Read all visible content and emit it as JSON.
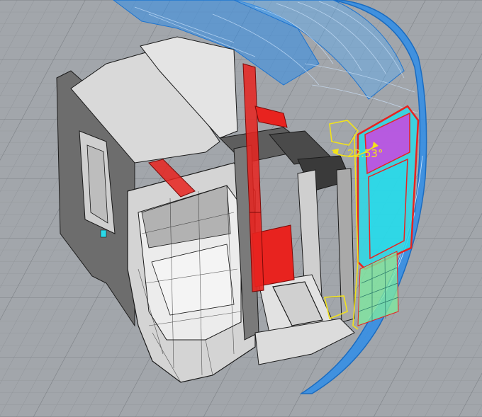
{
  "viewport": {
    "background_color": "#a2a6ab",
    "grid_color": "#8f9398",
    "grid_major_color": "#7c8085"
  },
  "model": {
    "shell_color": "#2f8de8",
    "body_color": "#d9d9d9",
    "dark_panel_color": "#6d6d6d",
    "door_frame_color": "#e8231f",
    "glass_color": "#2ad9e8",
    "highlight_color": "#c44de0",
    "selection_color": "#f2e21a",
    "edge_color": "#1b1b1b"
  },
  "annotation": {
    "angle_label": "22.53°"
  }
}
